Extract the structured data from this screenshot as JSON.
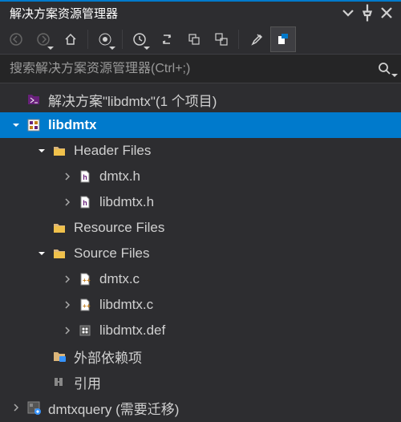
{
  "title": "解决方案资源管理器",
  "search": {
    "placeholder": "搜索解决方案资源管理器(Ctrl+;)"
  },
  "tree": [
    {
      "depth": 0,
      "arrow": "none",
      "icon": "solution",
      "name": "solution-node",
      "label": "解决方案\"libdmtx\"(1 个项目)"
    },
    {
      "depth": 0,
      "arrow": "open",
      "icon": "project",
      "name": "project-node",
      "label": "libdmtx",
      "selected": true
    },
    {
      "depth": 1,
      "arrow": "open",
      "icon": "folder",
      "name": "folder-header-files",
      "label": "Header Files"
    },
    {
      "depth": 2,
      "arrow": "closed",
      "icon": "hfile",
      "name": "file-dmtx-h",
      "label": "dmtx.h"
    },
    {
      "depth": 2,
      "arrow": "closed",
      "icon": "hfile",
      "name": "file-libdmtx-h",
      "label": "libdmtx.h"
    },
    {
      "depth": 1,
      "arrow": "none",
      "icon": "folder",
      "name": "folder-resource-files",
      "label": "Resource Files"
    },
    {
      "depth": 1,
      "arrow": "open",
      "icon": "folder",
      "name": "folder-source-files",
      "label": "Source Files"
    },
    {
      "depth": 2,
      "arrow": "closed",
      "icon": "cfile",
      "name": "file-dmtx-c",
      "label": "dmtx.c"
    },
    {
      "depth": 2,
      "arrow": "closed",
      "icon": "cfile",
      "name": "file-libdmtx-c",
      "label": "libdmtx.c"
    },
    {
      "depth": 2,
      "arrow": "closed",
      "icon": "def",
      "name": "file-libdmtx-def",
      "label": "libdmtx.def"
    },
    {
      "depth": 1,
      "arrow": "none",
      "icon": "ext",
      "name": "external-dependencies",
      "label": "外部依赖项"
    },
    {
      "depth": 1,
      "arrow": "none",
      "icon": "ref",
      "name": "references",
      "label": "引用"
    },
    {
      "depth": 0,
      "arrow": "closed",
      "icon": "project2",
      "name": "project-dmtxquery",
      "label": "dmtxquery (需要迁移)"
    }
  ]
}
